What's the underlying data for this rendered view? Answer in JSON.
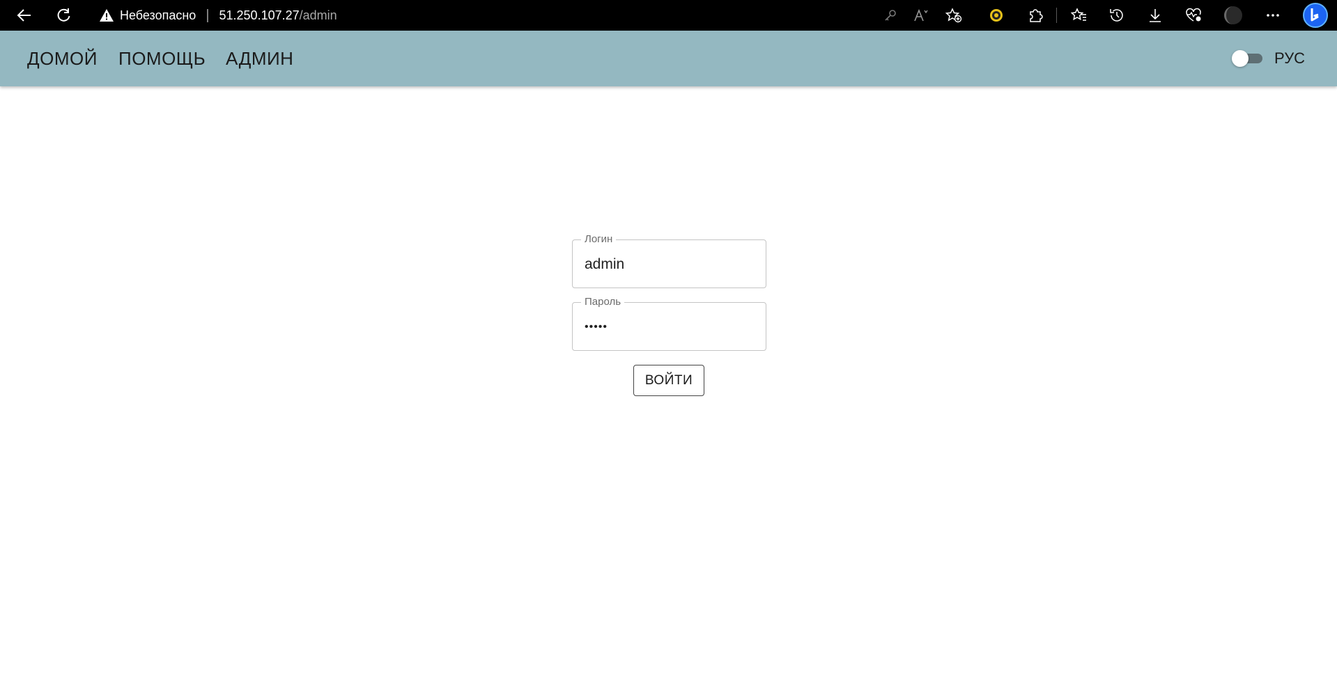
{
  "browser": {
    "security_label": "Небезопасно",
    "url_host": "51.250.107.27",
    "url_path": "/admin",
    "icons": [
      "back-icon",
      "refresh-icon",
      "warning-icon",
      "key-icon",
      "read-aloud-icon",
      "add-favorite-icon",
      "extension-coin-icon",
      "extensions-icon",
      "favorites-icon",
      "history-icon",
      "download-icon",
      "performance-icon",
      "profile-icon",
      "more-icon",
      "bing-icon"
    ]
  },
  "header": {
    "nav": [
      {
        "label": "ДОМОЙ"
      },
      {
        "label": "ПОМОЩЬ"
      },
      {
        "label": "АДМИН"
      }
    ],
    "lang_label": "РУС",
    "accent_color": "#94b8c1"
  },
  "form": {
    "login_label": "Логин",
    "login_value": "admin",
    "password_label": "Пароль",
    "password_value": "•••••",
    "submit_label": "ВОЙТИ"
  }
}
